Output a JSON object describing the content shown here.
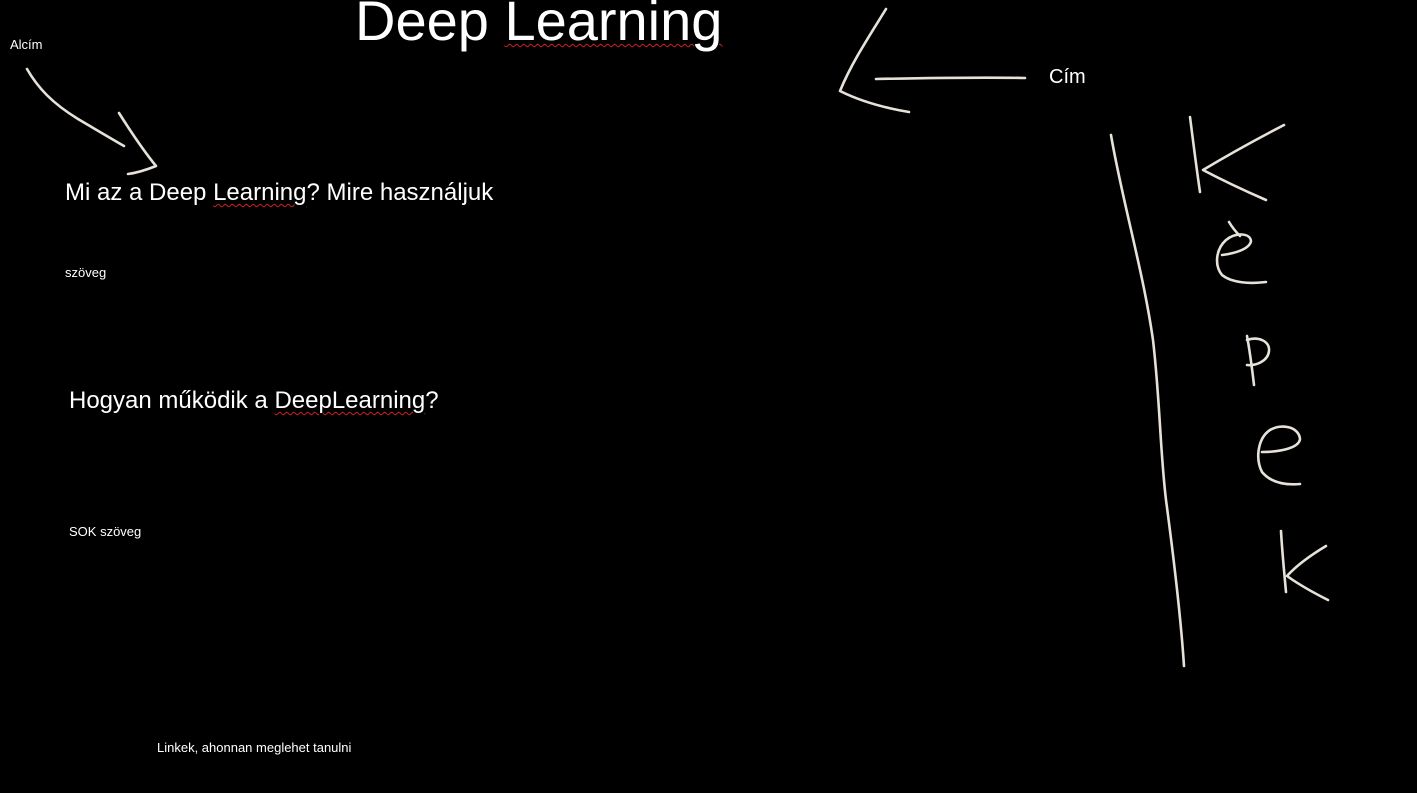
{
  "title": {
    "prefix": "Deep ",
    "misspelled": "Learning"
  },
  "labels": {
    "subtitle": "Alcím",
    "title": "Cím",
    "images_handwritten": "képek"
  },
  "sections": [
    {
      "heading_before": "Mi az a Deep ",
      "heading_misspelled": "Learning",
      "heading_after": "? Mire használjuk",
      "body": "szöveg"
    },
    {
      "heading_before": "Hogyan működik a ",
      "heading_misspelled": "DeepLearning",
      "heading_after": "?",
      "body": "SOK szöveg"
    }
  ],
  "footer": {
    "links": "Linkek, ahonnan meglehet tanulni"
  },
  "colors": {
    "background": "#000000",
    "text": "#ffffff",
    "sketch": "#e6e2da",
    "spellcheck": "#d02020"
  }
}
